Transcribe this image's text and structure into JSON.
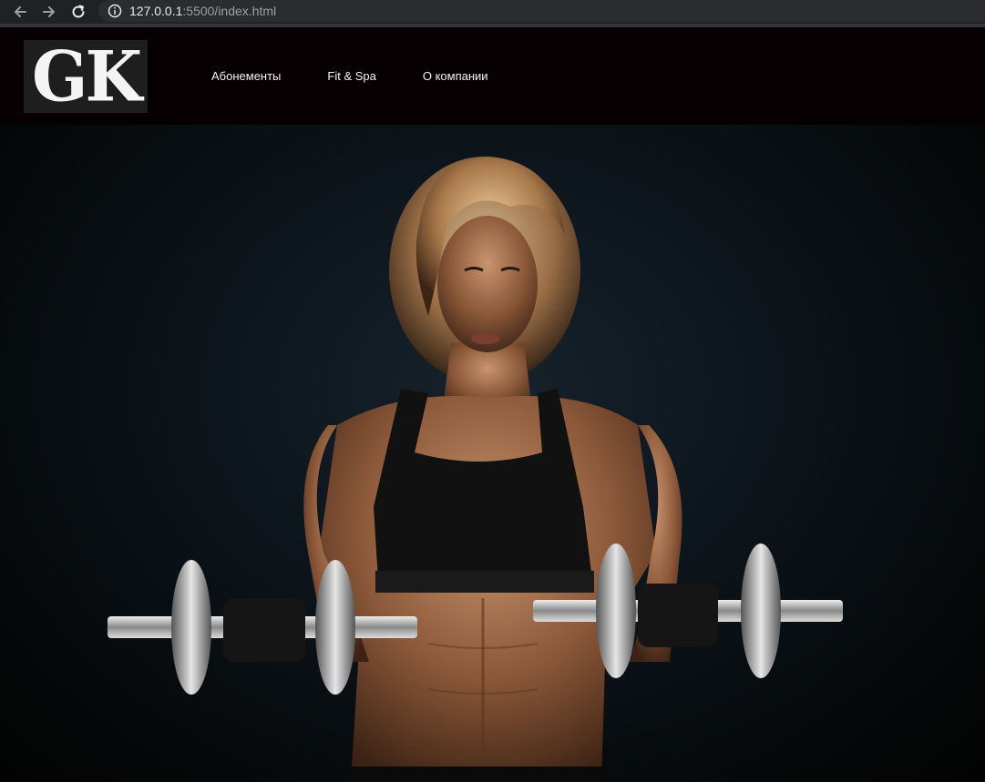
{
  "browser": {
    "url_host": "127.0.0.1",
    "url_path": ":5500/index.html"
  },
  "header": {
    "logo_text": "GK",
    "nav": [
      {
        "label": "Абонементы"
      },
      {
        "label": "Fit & Spa"
      },
      {
        "label": "О компании"
      }
    ]
  },
  "hero": {
    "image_subject": "woman lifting dumbbells"
  },
  "colors": {
    "header_bg": "#070003",
    "nav_text": "#f2f2f2",
    "hero_bg": "#0d151c",
    "browser_bar": "#202124"
  }
}
